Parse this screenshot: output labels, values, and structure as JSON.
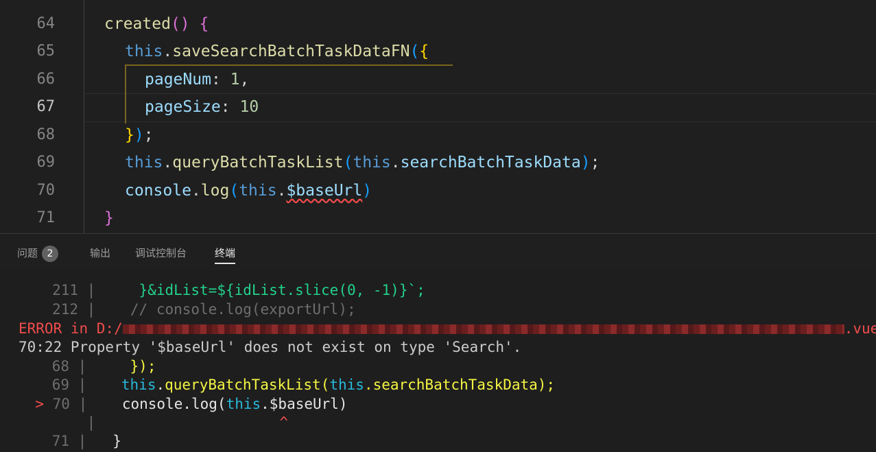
{
  "editor": {
    "gutter": [
      "64",
      "65",
      "66",
      "67",
      "68",
      "69",
      "70",
      "71"
    ],
    "lines": {
      "l64": {
        "name": "created",
        "paren": "()",
        "brace": "{"
      },
      "l65": {
        "this": "this",
        "dot": ".",
        "fn": "saveSearchBatchTaskDataFN",
        "open": "(",
        "brace": "{"
      },
      "l66": {
        "prop": "pageNum",
        "colon": ":",
        "val": "1",
        "comma": ","
      },
      "l67": {
        "prop": "pageSize",
        "colon": ":",
        "val": "10"
      },
      "l68": {
        "brace": "}",
        "paren": ")",
        "semi": ";"
      },
      "l69": {
        "this": "this",
        "dot": ".",
        "fn": "queryBatchTaskList",
        "open": "(",
        "arg_this": "this",
        "arg_dot": ".",
        "arg": "searchBatchTaskData",
        "close": ")",
        "semi": ";"
      },
      "l70": {
        "obj": "console",
        "dot": ".",
        "fn": "log",
        "open": "(",
        "this": "this",
        "dot2": ".",
        "prop": "$baseUrl",
        "close": ")"
      },
      "l71": {
        "brace": "}"
      }
    }
  },
  "panel": {
    "tabs": [
      {
        "label": "问题",
        "badge": "2"
      },
      {
        "label": "输出"
      },
      {
        "label": "调试控制台"
      },
      {
        "label": "终端"
      }
    ]
  },
  "terminal": {
    "l211": {
      "num": "211",
      "bar": "|",
      "code": "}&idList=${idList.slice(0, -1)}`;"
    },
    "l212": {
      "num": "212",
      "bar": "|",
      "code": "// console.log(exportUrl);"
    },
    "error_prefix": "ERROR in D:/",
    "error_suffix": ".vue",
    "message": "70:22 Property '$baseUrl' does not exist on type 'Search'.",
    "l68": {
      "num": "68",
      "bar": "|",
      "code": "});"
    },
    "l69": {
      "num": "69",
      "bar": "|",
      "this": "this",
      "dot": ".",
      "rest": "queryBatchTaskList(",
      "arg_this": "this",
      "arg_rest": ".searchBatchTaskData);"
    },
    "l70": {
      "marker": ">",
      "num": "70",
      "bar": "|",
      "pre": "console.log(",
      "this": "this",
      "post": ".$baseUrl)"
    },
    "caret": {
      "bar": "|",
      "char": "^"
    },
    "l71": {
      "num": "71",
      "bar": "|",
      "code": "}"
    }
  }
}
